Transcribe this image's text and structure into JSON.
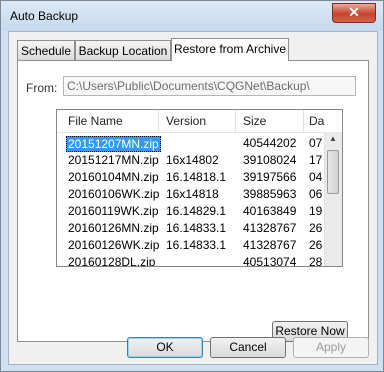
{
  "window": {
    "title": "Auto Backup",
    "close_glyph": "✕"
  },
  "tabs": [
    {
      "label": "Schedule"
    },
    {
      "label": "Backup Location"
    },
    {
      "label": "Restore from Archive"
    }
  ],
  "restore": {
    "from_label": "From:",
    "from_path": "C:\\Users\\Public\\Documents\\CQGNet\\Backup\\",
    "columns": [
      "File Name",
      "Version",
      "Size",
      "Da"
    ],
    "rows": [
      {
        "name": "20151207MN.zip",
        "version": "",
        "size": "40544202",
        "date": "07"
      },
      {
        "name": "20151217MN.zip",
        "version": "16x14802",
        "size": "39108024",
        "date": "17"
      },
      {
        "name": "20160104MN.zip",
        "version": "16.14818.1",
        "size": "39197566",
        "date": "04"
      },
      {
        "name": "20160106WK.zip",
        "version": "16x14818",
        "size": "39885963",
        "date": "06"
      },
      {
        "name": "20160119WK.zip",
        "version": "16.14829.1",
        "size": "40163849",
        "date": "19"
      },
      {
        "name": "20160126MN.zip",
        "version": "16.14833.1",
        "size": "41328767",
        "date": "26"
      },
      {
        "name": "20160126WK.zip",
        "version": "16.14833.1",
        "size": "41328767",
        "date": "26"
      },
      {
        "name": "20160128DL.zip",
        "version": "",
        "size": "40513074",
        "date": "28"
      }
    ],
    "restore_button": "Restore Now"
  },
  "footer": {
    "ok": "OK",
    "cancel": "Cancel",
    "apply": "Apply"
  }
}
